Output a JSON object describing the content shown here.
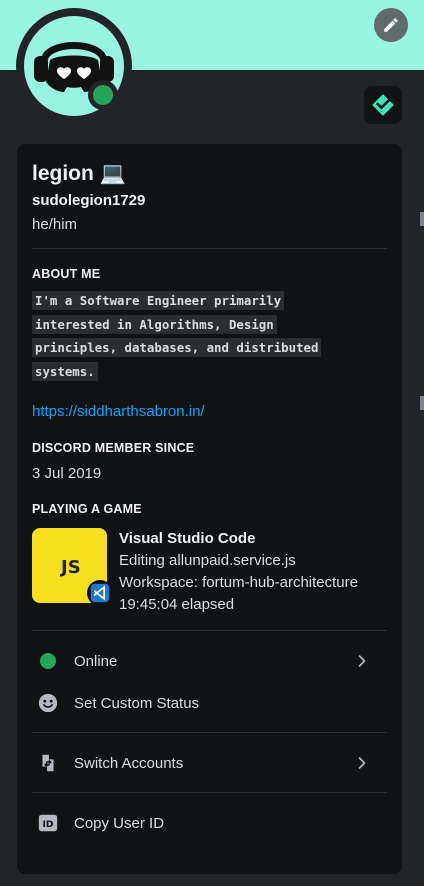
{
  "colors": {
    "banner": "#97f4de",
    "online": "#23a55a",
    "link": "#00a8fc",
    "card_bg": "#111214",
    "panel_bg": "#232428"
  },
  "profile": {
    "display_name": "legion 💻",
    "username": "sudolegion1729",
    "pronouns": "he/him",
    "status": "online"
  },
  "about": {
    "title": "ABOUT ME",
    "bio_lines": [
      "I'm a Software Engineer primarily",
      "interested in Algorithms, Design",
      "principles, databases, and distributed",
      "systems."
    ],
    "website": "https://siddharthsabron.in/"
  },
  "member_since": {
    "title": "DISCORD MEMBER SINCE",
    "date": "3 Jul 2019"
  },
  "activity": {
    "title": "PLAYING A GAME",
    "art_label": "JS",
    "name": "Visual Studio Code",
    "details": "Editing allunpaid.service.js",
    "state": "Workspace: fortum-hub-architecture",
    "elapsed": "19:45:04 elapsed"
  },
  "menu": {
    "online_label": "Online",
    "custom_status_label": "Set Custom Status",
    "switch_accounts_label": "Switch Accounts",
    "copy_id_label": "Copy User ID",
    "copy_id_badge": "ID"
  },
  "icons": {
    "edit": "pencil-icon",
    "badge": "nitro-gem-icon",
    "custom_status": "smiley-icon",
    "switch": "switch-accounts-icon",
    "copy_id": "id-icon",
    "chevron": "chevron-right-icon",
    "vscode": "vscode-icon"
  }
}
